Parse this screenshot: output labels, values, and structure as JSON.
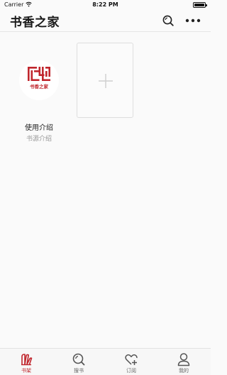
{
  "status_bar": {
    "carrier": "Carrier",
    "time": "8:22 PM"
  },
  "nav": {
    "title": "书香之家",
    "search_icon": "search-icon",
    "more_icon": "more-icon"
  },
  "bookshelf": {
    "items": [
      {
        "title": "使用介绍",
        "subtitle": "书源介绍",
        "logo_text": "书香之家",
        "icon": "logo-icon"
      }
    ],
    "add_icon": "plus-icon"
  },
  "tabs": [
    {
      "label": "书架",
      "icon": "bookshelf-icon",
      "active": true
    },
    {
      "label": "搜书",
      "icon": "search-book-icon",
      "active": false
    },
    {
      "label": "订阅",
      "icon": "subscribe-icon",
      "active": false
    },
    {
      "label": "我的",
      "icon": "profile-icon",
      "active": false
    }
  ],
  "colors": {
    "accent": "#c0262d",
    "background": "#fafafa",
    "tab_inactive": "#666666"
  }
}
